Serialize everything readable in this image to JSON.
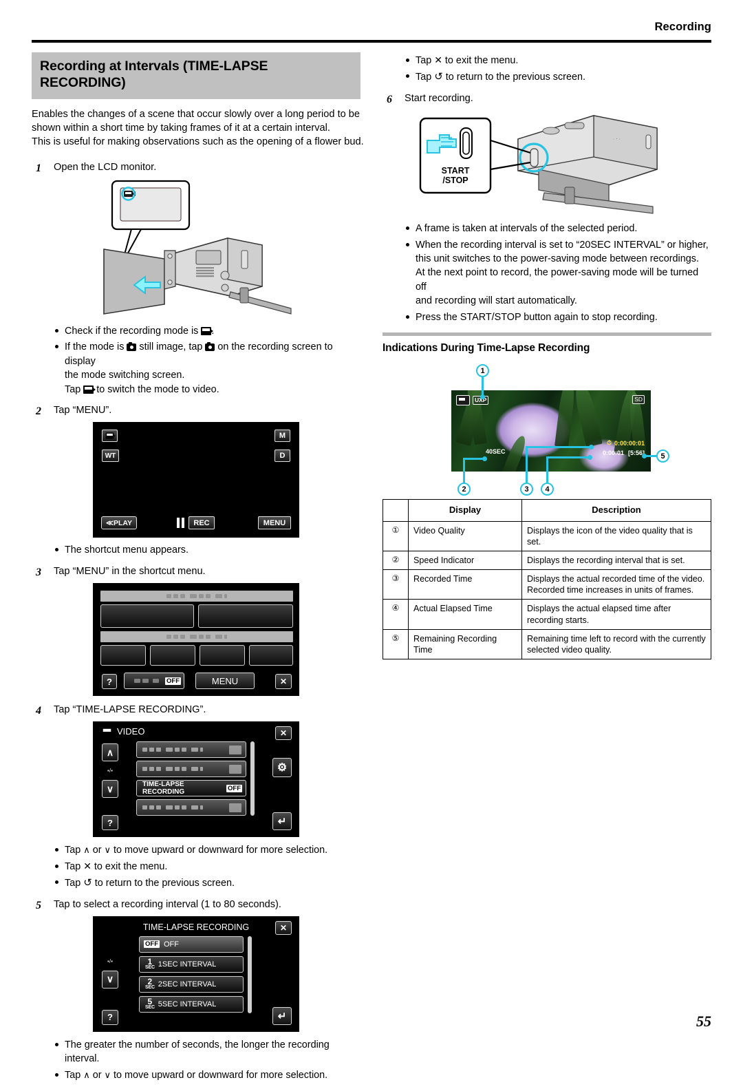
{
  "header": {
    "title": "Recording"
  },
  "page_number": "55",
  "left_column": {
    "section_title": "Recording at Intervals (TIME-LAPSE RECORDING)",
    "intro_lines": [
      "Enables the changes of a scene that occur slowly over a long period to be",
      "shown within a short time by taking frames of it at a certain interval.",
      "This is useful for making observations such as the opening of a flower bud."
    ],
    "step1": {
      "num": "1",
      "text": "Open the LCD monitor."
    },
    "step1_bullets": [
      {
        "pre": "Check if the recording mode is ",
        "icon": "video-mode-icon",
        "post": "."
      },
      {
        "pre": "If the mode is ",
        "icon": "still-image-icon",
        "mid": " still image, tap ",
        "icon2": "still-image-icon",
        "post": " on the recording screen to display",
        "cont1": "the mode switching screen.",
        "cont2_pre": "Tap ",
        "cont2_icon": "video-mode-icon",
        "cont2_post": " to switch the mode to video."
      }
    ],
    "step2": {
      "num": "2",
      "text": "Tap “MENU”."
    },
    "rec_screen": {
      "mode_icon": "video-mode-icon",
      "manual_label": "M",
      "zoom_label": "WT",
      "display_label": "D",
      "play_label": "≪PLAY",
      "rec_label": "REC",
      "menu_label": "MENU",
      "pause_icon": "pause-icon"
    },
    "step2_bullets": [
      {
        "pre": "The shortcut menu appears."
      }
    ],
    "step3": {
      "num": "3",
      "text": "Tap “MENU” in the shortcut menu."
    },
    "shortcut_screen": {
      "help_label": "?",
      "off_label": "OFF",
      "menu_label": "MENU",
      "close_label": "✕"
    },
    "step4": {
      "num": "4",
      "text": "Tap “TIME-LAPSE RECORDING”."
    },
    "video_menu_screen": {
      "mode_icon": "video-camera-icon",
      "title": "VIDEO",
      "close_label": "✕",
      "up_label": "∧",
      "down_label": "∨",
      "page_label": "▪/▪",
      "help_label": "?",
      "gear_icon": "gear-icon",
      "back_icon": "back-arrow-icon",
      "highlight_item": "TIME-LAPSE RECORDING",
      "highlight_value": "OFF"
    },
    "step4_bullets": [
      {
        "pre": "Tap ",
        "g1": "∧",
        "mid": " or ",
        "g2": "∨",
        "post": " to move upward or downward for more selection."
      },
      {
        "pre": "Tap ",
        "g1": "✕",
        "post": " to exit the menu."
      },
      {
        "pre": "Tap ",
        "g1": "↺",
        "post": " to return to the previous screen."
      }
    ],
    "step5": {
      "num": "5",
      "text": "Tap to select a recording interval (1 to 80 seconds)."
    },
    "interval_screen": {
      "title": "TIME-LAPSE RECORDING",
      "close_label": "✕",
      "page_label": "▪/▪",
      "down_label": "∨",
      "help_label": "?",
      "back_icon": "back-arrow-icon",
      "options": [
        {
          "badge": "OFF",
          "badge_sub": "",
          "label": "OFF",
          "selected": true
        },
        {
          "badge": "1",
          "badge_sub": "SEC",
          "label": "1SEC INTERVAL",
          "selected": false
        },
        {
          "badge": "2",
          "badge_sub": "SEC",
          "label": "2SEC INTERVAL",
          "selected": false
        },
        {
          "badge": "5",
          "badge_sub": "SEC",
          "label": "5SEC INTERVAL",
          "selected": false
        }
      ]
    },
    "step5_bullets": [
      {
        "pre": "The greater the number of seconds, the longer the recording interval."
      },
      {
        "pre": "Tap ",
        "g1": "∧",
        "mid": " or ",
        "g2": "∨",
        "post": " to move upward or downward for more selection."
      }
    ]
  },
  "right_column": {
    "top_bullets": [
      {
        "pre": "Tap ",
        "g1": "✕",
        "post": " to exit the menu."
      },
      {
        "pre": "Tap ",
        "g1": "↺",
        "post": " to return to the previous screen."
      }
    ],
    "step6": {
      "num": "6",
      "text": "Start recording."
    },
    "camcorder": {
      "button_label_line1": "START",
      "button_label_line2": "/STOP",
      "hand_icon": "pointing-hand-icon"
    },
    "step6_bullets": [
      {
        "pre": "A frame is taken at intervals of the selected period."
      },
      {
        "pre": "When the recording interval is set to “20SEC INTERVAL” or higher,",
        "cont1": "this unit switches to the power-saving mode between recordings.",
        "cont2": "At the next point to record, the power-saving mode will be turned off",
        "cont3": "and recording will start automatically."
      },
      {
        "pre": "Press the START/STOP button again to stop recording."
      }
    ],
    "subsection_title": "Indications During Time-Lapse Recording",
    "photo_osd": {
      "video_icon": "video-mode-icon",
      "quality_badge": "UXP",
      "media_badge": "SD",
      "speed_indicator": "40SEC",
      "recorded_time": "0:00:00:01",
      "recorded_time_icon": "time-lapse-icon",
      "actual_elapsed": "0:00:01",
      "remaining": "[5:56]",
      "callouts": [
        "1",
        "2",
        "3",
        "4",
        "5"
      ]
    },
    "table": {
      "headers": [
        "",
        "Display",
        "Description"
      ],
      "rows": [
        {
          "num": "①",
          "display": "Video Quality",
          "desc_lines": [
            "Displays the icon of the video quality that is set."
          ]
        },
        {
          "num": "②",
          "display": "Speed Indicator",
          "desc_lines": [
            "Displays the recording interval that is set."
          ]
        },
        {
          "num": "③",
          "display": "Recorded Time",
          "desc_lines": [
            "Displays the actual recorded time of the video.",
            "Recorded time increases in units of frames."
          ]
        },
        {
          "num": "④",
          "display": "Actual Elapsed Time",
          "desc_lines": [
            "Displays the actual elapsed time after",
            "recording starts."
          ]
        },
        {
          "num": "⑤",
          "display": "Remaining Recording Time",
          "desc_lines": [
            "Remaining time left to record with the currently",
            "selected video quality."
          ]
        }
      ]
    }
  },
  "colors": {
    "banner_gray": "#c0c0c0",
    "callout_cyan": "#27c3e0",
    "osd_yellow": "#ffe54d"
  }
}
